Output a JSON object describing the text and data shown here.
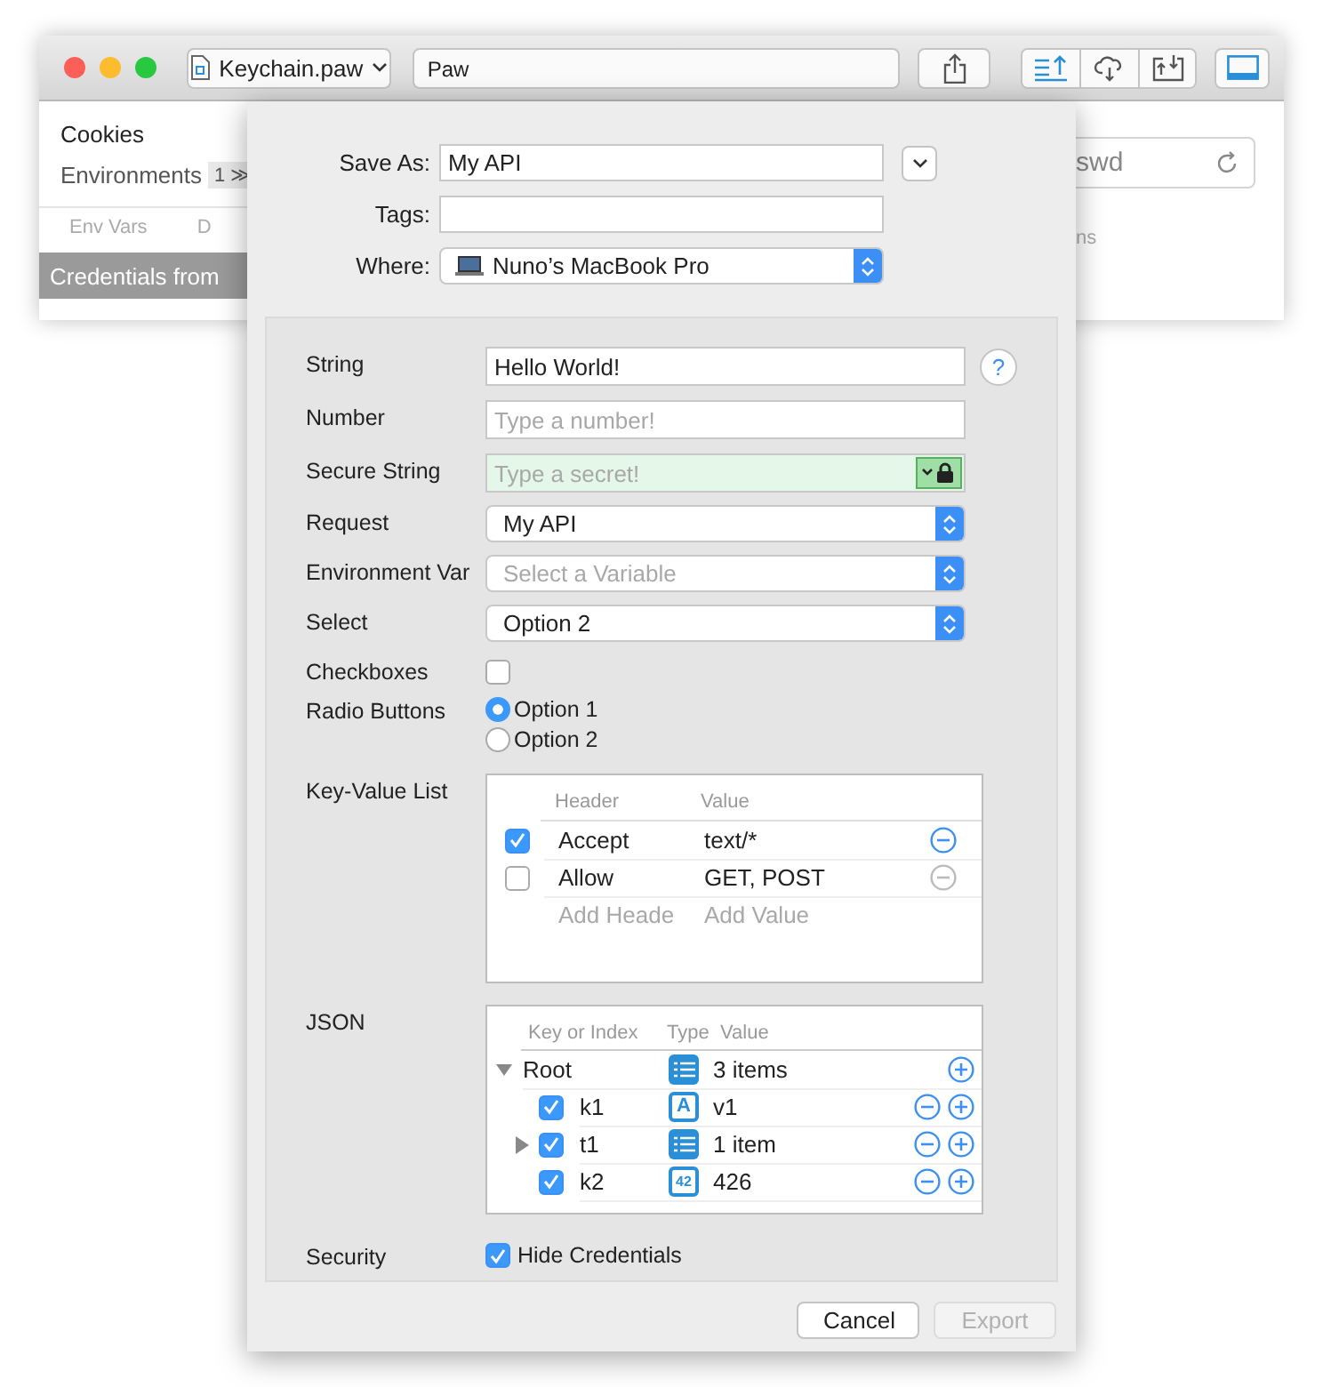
{
  "toolbar": {
    "document_menu": "Keychain.paw",
    "address": "Paw"
  },
  "background": {
    "sidebar_item": "Cookies",
    "environments": {
      "label": "Environments",
      "count": "1 ≫"
    },
    "tabs": [
      "Env Vars",
      "D"
    ],
    "banner": "Credentials from",
    "field_value": "swd",
    "column_header": "ns"
  },
  "sheet": {
    "save_as": {
      "label": "Save As:",
      "value": "My API"
    },
    "tags": {
      "label": "Tags:"
    },
    "where": {
      "label": "Where:",
      "value": "Nuno’s MacBook Pro"
    },
    "fields": [
      {
        "kind": "text",
        "label": "String",
        "value": "Hello World!",
        "help": "?"
      },
      {
        "kind": "text",
        "label": "Number",
        "placeholder": "Type a number!"
      },
      {
        "kind": "secure",
        "label": "Secure String",
        "placeholder": "Type a secret!"
      },
      {
        "kind": "select",
        "label": "Request",
        "value": "My API"
      },
      {
        "kind": "select",
        "label": "Environment Var",
        "placeholder": "Select a Variable"
      },
      {
        "kind": "select",
        "label": "Select",
        "value": "Option 2"
      },
      {
        "kind": "checkbox",
        "label": "Checkboxes",
        "checked": false
      },
      {
        "kind": "radio",
        "label": "Radio Buttons",
        "options": [
          {
            "label": "Option 1",
            "selected": true
          },
          {
            "label": "Option 2",
            "selected": false
          }
        ]
      },
      {
        "kind": "keyvalue",
        "label": "Key-Value List",
        "columns": [
          "Header",
          "Value"
        ],
        "rows": [
          {
            "checked": true,
            "key": "Accept",
            "value": "text/*",
            "disabled": false
          },
          {
            "checked": false,
            "key": "Allow",
            "value": "GET, POST",
            "disabled": true
          }
        ],
        "key_placeholder": "Add Heade",
        "value_placeholder": "Add Value"
      },
      {
        "kind": "json",
        "label": "JSON",
        "columns": [
          "Key or Index",
          "Type",
          "Value"
        ],
        "root": {
          "key": "Root",
          "kind": "list",
          "value": "3 items",
          "expanded": true,
          "children": [
            {
              "key": "k1",
              "kind": "string",
              "type_label": "A",
              "value": "v1",
              "checked": true
            },
            {
              "key": "t1",
              "kind": "list",
              "value": "1 item",
              "checked": true,
              "expanded": false
            },
            {
              "key": "k2",
              "kind": "number",
              "type_label": "42",
              "value": "426",
              "checked": true
            }
          ]
        }
      },
      {
        "kind": "check_label",
        "label": "Security",
        "text": "Hide Credentials",
        "checked": true
      }
    ],
    "buttons": [
      {
        "label": "Cancel",
        "disabled": false
      },
      {
        "label": "Export",
        "disabled": true
      }
    ]
  }
}
